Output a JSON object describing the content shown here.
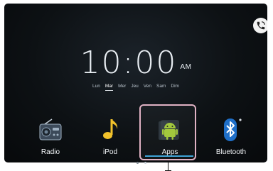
{
  "clock": {
    "time": "10:00",
    "ampm": "AM"
  },
  "days": [
    "Lun",
    "Mar",
    "Mer",
    "Jeu",
    "Ven",
    "Sam",
    "Dim"
  ],
  "active_day": "Mar",
  "dock": {
    "apps": [
      {
        "label": "Radio",
        "icon": "radio-icon"
      },
      {
        "label": "iPod",
        "icon": "music-note-icon"
      },
      {
        "label": "Apps",
        "icon": "android-icon",
        "selected": true
      },
      {
        "label": "Bluetooth",
        "icon": "bluetooth-icon"
      }
    ]
  },
  "top_right": {
    "icon": "phone-icon"
  },
  "colors": {
    "selection_border": "#e0b2c4",
    "selection_underline": "#3fa3d6",
    "android_green": "#9fc637",
    "bluetooth_blue": "#1f6fc8"
  }
}
